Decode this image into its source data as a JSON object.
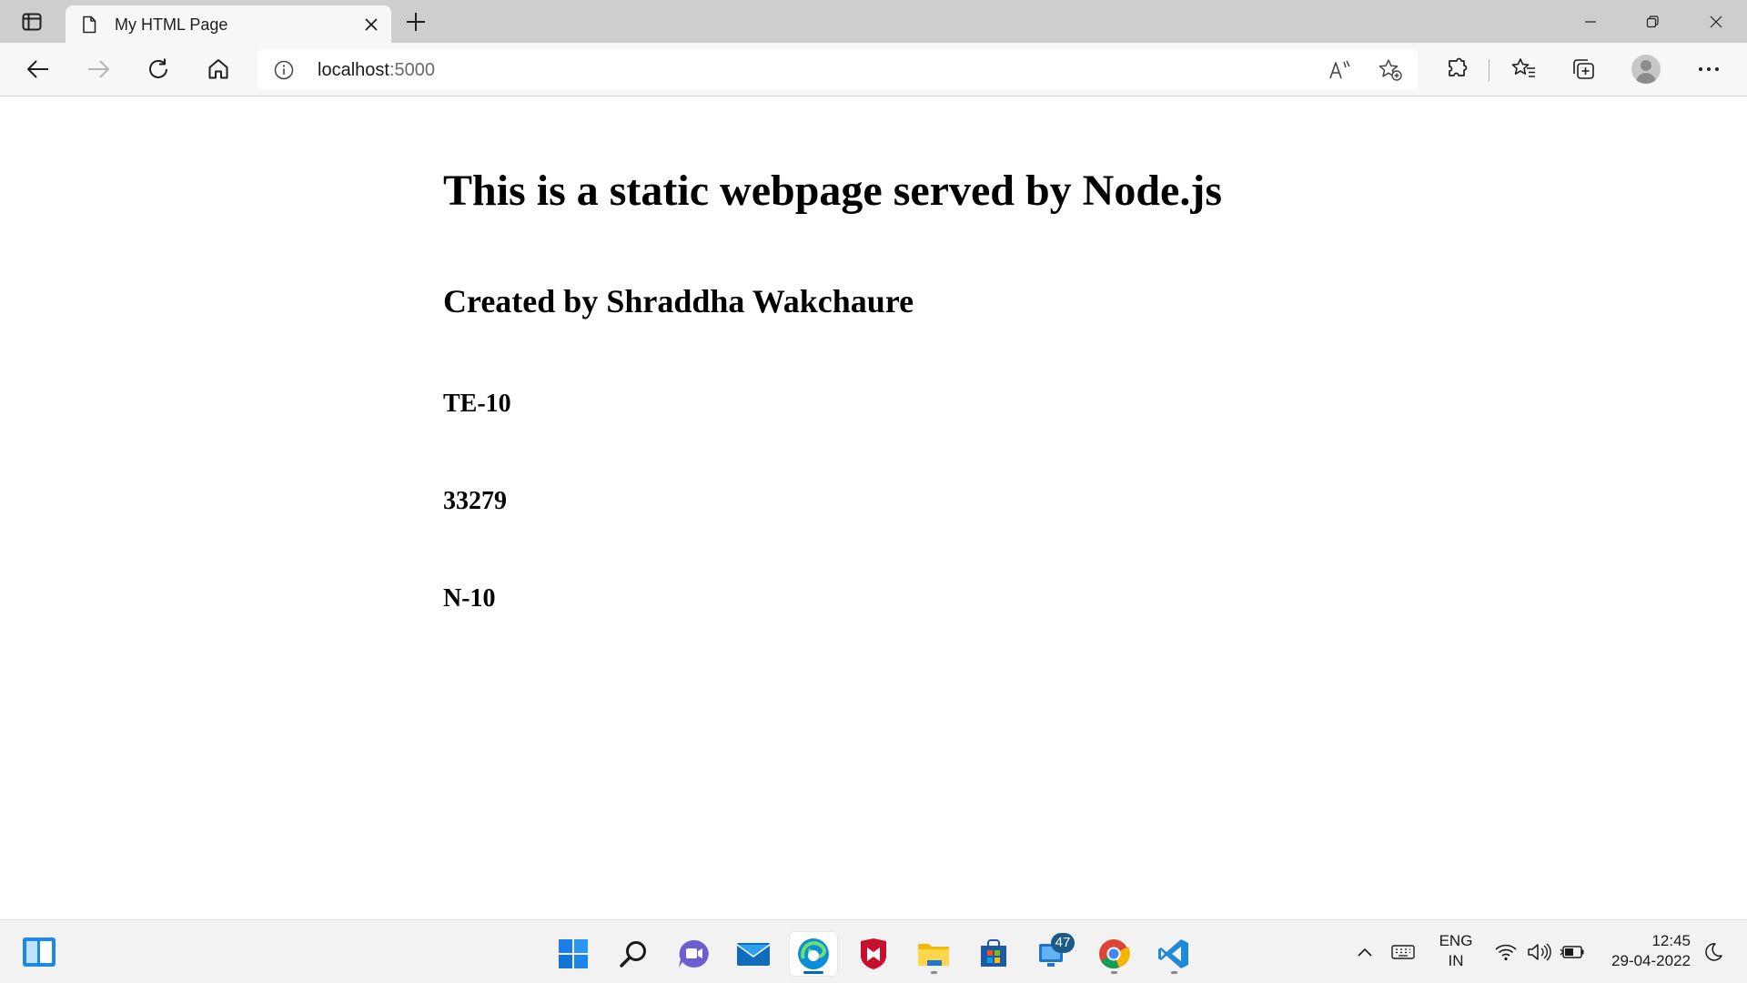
{
  "browser": {
    "tab": {
      "title": "My HTML Page",
      "favicon": "document-icon"
    },
    "address_bar": {
      "host": "localhost",
      "port": ":5000"
    },
    "icons": [
      "tab-actions-icon",
      "close-icon",
      "plus-icon",
      "minimize-icon",
      "restore-icon",
      "back-arrow-icon",
      "forward-arrow-icon",
      "refresh-icon",
      "home-icon",
      "info-icon",
      "read-aloud-icon",
      "add-favorite-icon",
      "extensions-icon",
      "favorites-icon",
      "collections-icon",
      "profile-avatar",
      "more-icon"
    ]
  },
  "page": {
    "heading": "This is a static webpage served by Node.js",
    "subheading": "Created by Shraddha Wakchaure",
    "lines": [
      "TE-10",
      "33279",
      "N-10"
    ]
  },
  "taskbar": {
    "apps": [
      "widgets-icon",
      "start-icon",
      "search-icon",
      "chat-icon",
      "mail-icon",
      "edge-icon",
      "mcafee-icon",
      "file-explorer-icon",
      "store-icon",
      "app-updates-icon",
      "chrome-icon",
      "vscode-icon"
    ],
    "badge_count": "47",
    "tray": {
      "language": "ENG",
      "region": "IN",
      "time": "12:45",
      "date": "29-04-2022"
    }
  },
  "colors": {
    "tabstrip": "#cecece",
    "toolbar": "#f7f7f7",
    "taskbar": "#f2f2f2",
    "accent": "#0067c0"
  }
}
